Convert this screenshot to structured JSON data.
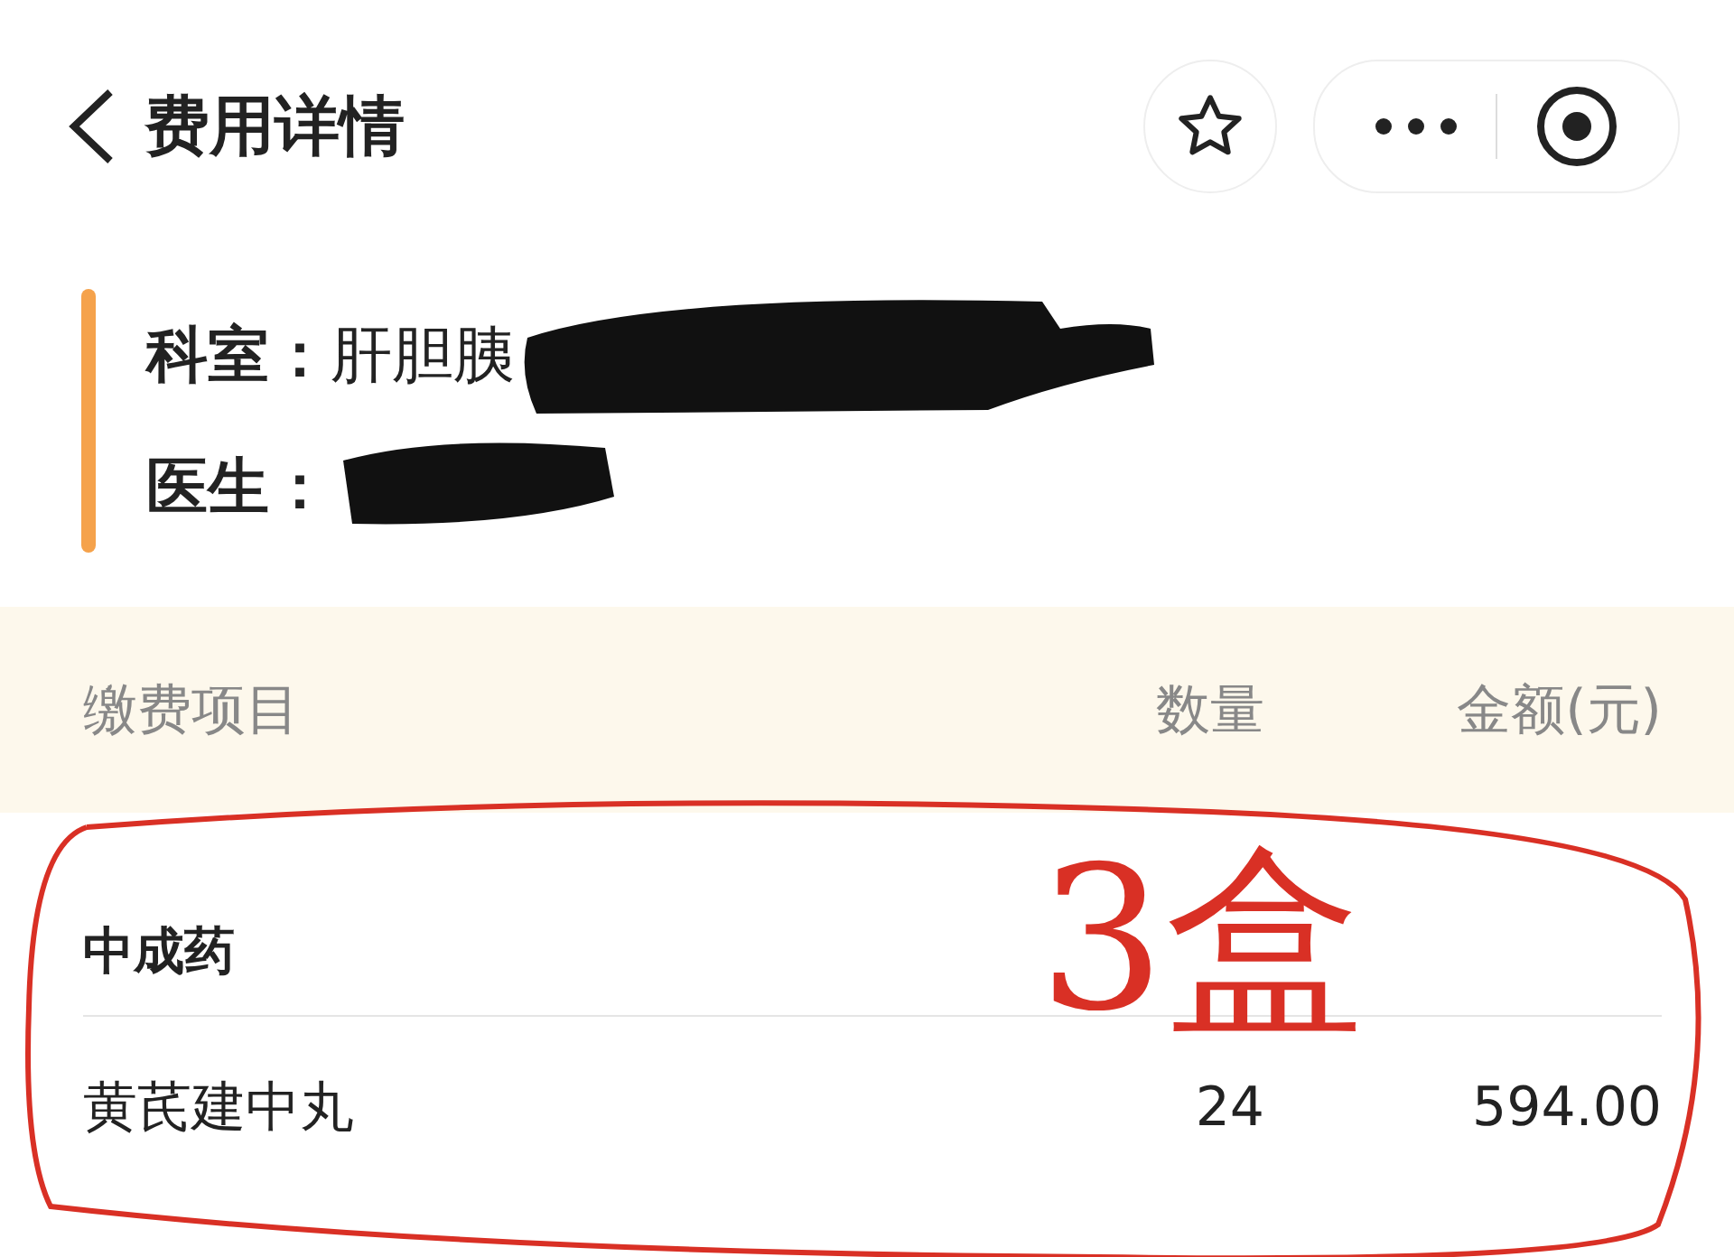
{
  "header": {
    "title": "费用详情"
  },
  "info": [
    {
      "label": "科室：",
      "value": "肝胆胰"
    },
    {
      "label": "医生："
    }
  ],
  "table": {
    "columns": [
      "缴费项目",
      "数量",
      "金额(元)"
    ],
    "groups": [
      {
        "name": "中成药",
        "rows": [
          {
            "item": "黄芪建中丸",
            "quantity": "24",
            "amount": "594.00"
          }
        ]
      }
    ]
  },
  "annotation": {
    "text": "3盒"
  }
}
